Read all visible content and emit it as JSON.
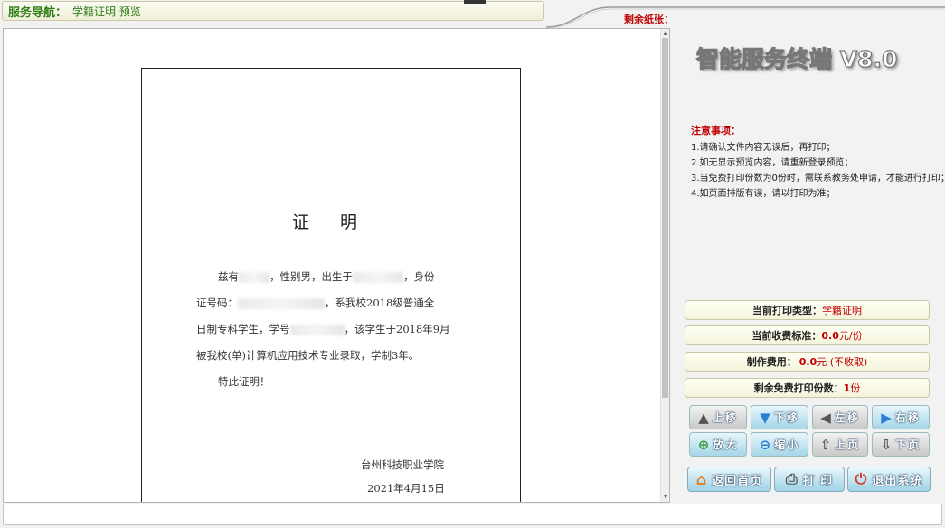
{
  "nav": {
    "label": "服务导航：",
    "path": "学籍证明 预览"
  },
  "paper_remaining_label": "剩余纸张：",
  "app_title": "智能服务终端 V8.0",
  "notice": {
    "heading": "注意事项：",
    "items": [
      "1.请确认文件内容无误后，再打印；",
      "2.如无显示预览内容，请重新登录预览；",
      "3.当免费打印份数为0份时，需联系教务处申请，才能进行打印；",
      "4.如页面排版有误，请以打印为准；"
    ]
  },
  "document": {
    "title": "证 明",
    "line1_a": "兹有",
    "line1_b": "，性别男，出生于",
    "line1_c": "，身份",
    "line2_a": "证号码：",
    "line2_b": "，系我校2018级普通全",
    "line3_a": "日制专科学生，学号",
    "line3_b": "，该学生于2018年9月",
    "line4": "被我校(单)计算机应用技术专业录取，学制3年。",
    "line5": "特此证明！",
    "school": "台州科技职业学院",
    "date": "2021年4月15日"
  },
  "info": {
    "print_type_label": "当前打印类型：",
    "print_type_value": "学籍证明",
    "fee_standard_label": "当前收费标准：",
    "fee_standard_num": "0.0",
    "fee_standard_unit": " 元/份",
    "fee_label": "制作费用：",
    "fee_num": "0.0",
    "fee_unit": " 元 (不收取)",
    "free_label": "剩余免费打印份数：",
    "free_num": "1",
    "free_unit": " 份"
  },
  "buttons": {
    "up": "上移",
    "down": "下移",
    "left": "左移",
    "right": "右移",
    "zoom_in": "放大",
    "zoom_out": "缩小",
    "prev_page": "上页",
    "next_page": "下页",
    "home": "返回首页",
    "print": "打 印",
    "exit": "退出系统"
  },
  "icons": {
    "up": "arrow-up-icon",
    "down": "arrow-down-icon",
    "left": "arrow-left-icon",
    "right": "arrow-right-icon",
    "zoom_in": "zoom-in-icon",
    "zoom_out": "zoom-out-icon",
    "prev_page": "page-up-icon",
    "next_page": "page-down-icon",
    "home": "home-icon",
    "print": "printer-icon",
    "exit": "power-icon"
  },
  "colors": {
    "nav_green": "#2e7d14",
    "warning_red": "#c00000",
    "button_blue": "#a6d6e8"
  }
}
